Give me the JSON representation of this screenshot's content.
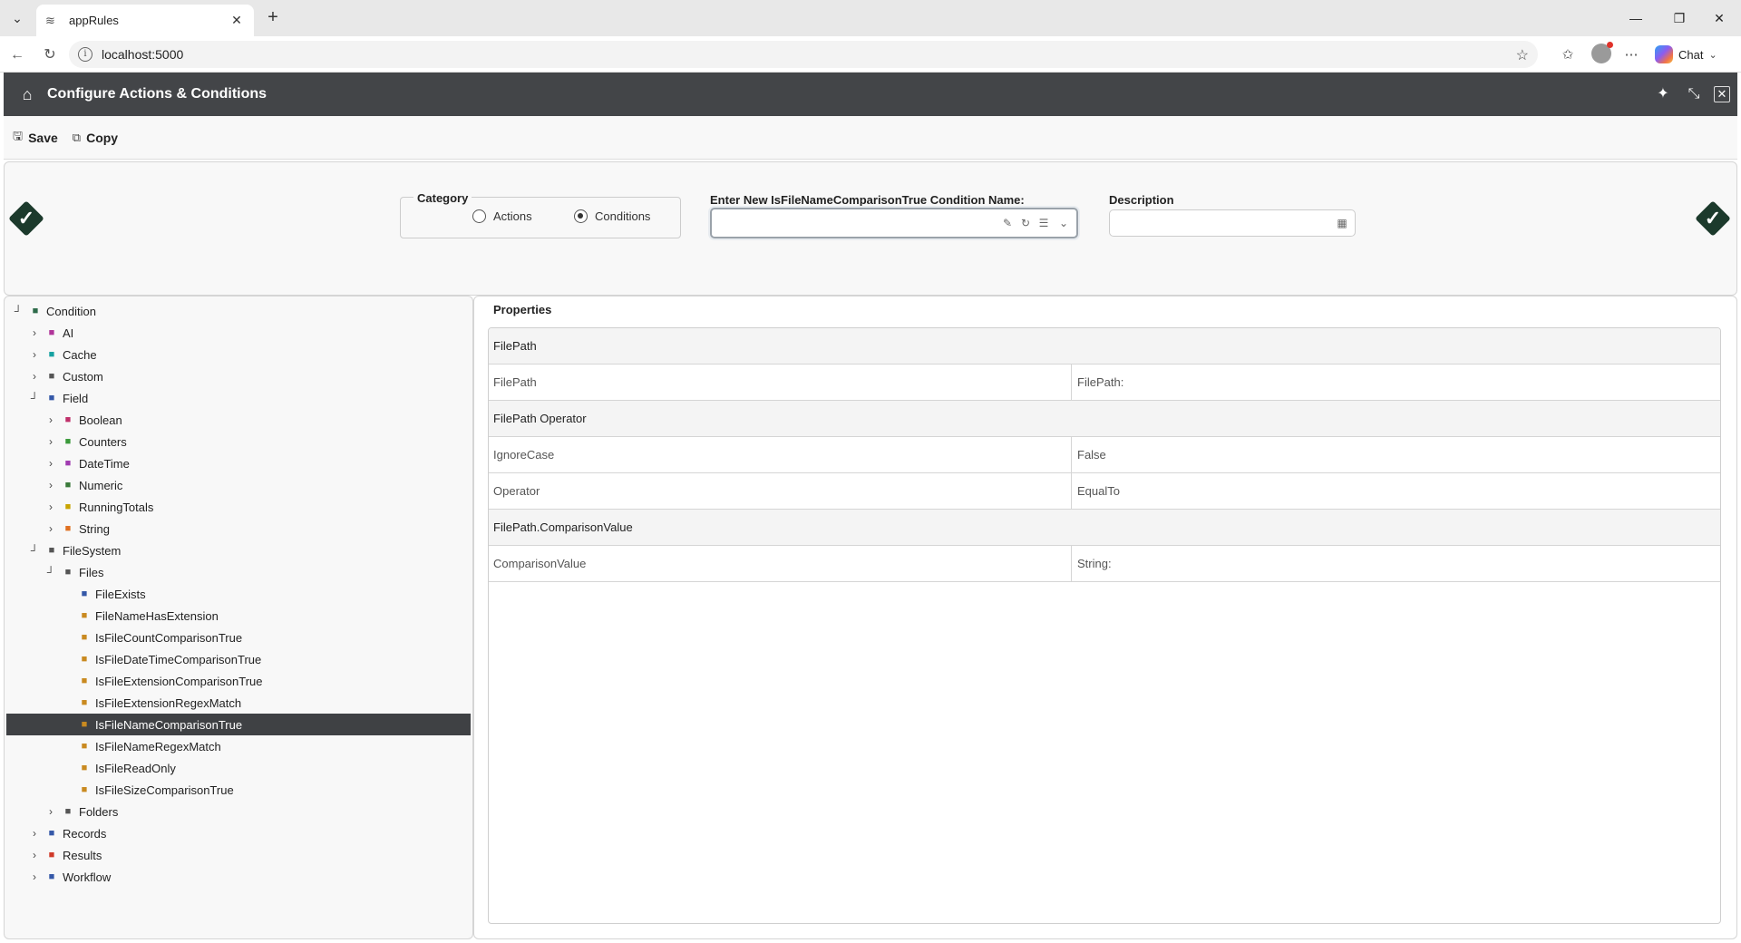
{
  "browser": {
    "tab_title": "appRules",
    "url": "localhost:5000",
    "chat_label": "Chat"
  },
  "app": {
    "title": "Configure Actions & Conditions"
  },
  "toolbar": {
    "save_label": "Save",
    "copy_label": "Copy"
  },
  "form": {
    "category_label": "Category",
    "category_options": [
      "Actions",
      "Conditions"
    ],
    "category_selected": "Conditions",
    "name_label": "Enter New IsFileNameComparisonTrue Condition Name:",
    "name_value": "",
    "description_label": "Description",
    "description_value": ""
  },
  "tree": {
    "items": [
      {
        "label": "Condition",
        "level": 0,
        "toggle": "collapse",
        "icon": "condition-icon",
        "color": "#2e6b4a"
      },
      {
        "label": "AI",
        "level": 1,
        "toggle": "expand",
        "icon": "ai-icon",
        "color": "#b0359a"
      },
      {
        "label": "Cache",
        "level": 1,
        "toggle": "expand",
        "icon": "cache-icon",
        "color": "#17a2a2"
      },
      {
        "label": "Custom",
        "level": 1,
        "toggle": "expand",
        "icon": "code-icon",
        "color": "#555555"
      },
      {
        "label": "Field",
        "level": 1,
        "toggle": "collapse",
        "icon": "field-icon",
        "color": "#3558a8"
      },
      {
        "label": "Boolean",
        "level": 2,
        "toggle": "expand",
        "icon": "boolean-icon",
        "color": "#c0306a"
      },
      {
        "label": "Counters",
        "level": 2,
        "toggle": "expand",
        "icon": "counters-icon",
        "color": "#3a9a3a"
      },
      {
        "label": "DateTime",
        "level": 2,
        "toggle": "expand",
        "icon": "calendar-icon",
        "color": "#a03ab0"
      },
      {
        "label": "Numeric",
        "level": 2,
        "toggle": "expand",
        "icon": "numeric-icon",
        "color": "#3a7a3a"
      },
      {
        "label": "RunningTotals",
        "level": 2,
        "toggle": "expand",
        "icon": "bar-chart-icon",
        "color": "#c9a400"
      },
      {
        "label": "String",
        "level": 2,
        "toggle": "expand",
        "icon": "string-icon",
        "color": "#e07020"
      },
      {
        "label": "FileSystem",
        "level": 1,
        "toggle": "collapse",
        "icon": "filesystem-icon",
        "color": "#555555"
      },
      {
        "label": "Files",
        "level": 2,
        "toggle": "collapse",
        "icon": "files-icon",
        "color": "#555555"
      },
      {
        "label": "FileExists",
        "level": 3,
        "toggle": "",
        "icon": "file-check-icon",
        "color": "#3558a8"
      },
      {
        "label": "FileNameHasExtension",
        "level": 3,
        "toggle": "",
        "icon": "file-ext-icon",
        "color": "#c98a20"
      },
      {
        "label": "IsFileCountComparisonTrue",
        "level": 3,
        "toggle": "",
        "icon": "file-icon",
        "color": "#c98a20"
      },
      {
        "label": "IsFileDateTimeComparisonTrue",
        "level": 3,
        "toggle": "",
        "icon": "file-icon",
        "color": "#c98a20"
      },
      {
        "label": "IsFileExtensionComparisonTrue",
        "level": 3,
        "toggle": "",
        "icon": "file-icon",
        "color": "#c98a20"
      },
      {
        "label": "IsFileExtensionRegexMatch",
        "level": 3,
        "toggle": "",
        "icon": "file-icon",
        "color": "#c98a20"
      },
      {
        "label": "IsFileNameComparisonTrue",
        "level": 3,
        "toggle": "",
        "icon": "file-icon",
        "color": "#c98a20",
        "selected": true
      },
      {
        "label": "IsFileNameRegexMatch",
        "level": 3,
        "toggle": "",
        "icon": "file-icon",
        "color": "#c98a20"
      },
      {
        "label": "IsFileReadOnly",
        "level": 3,
        "toggle": "",
        "icon": "file-lock-icon",
        "color": "#c98a20"
      },
      {
        "label": "IsFileSizeComparisonTrue",
        "level": 3,
        "toggle": "",
        "icon": "file-icon",
        "color": "#c98a20"
      },
      {
        "label": "Folders",
        "level": 2,
        "toggle": "expand",
        "icon": "folder-icon",
        "color": "#555555"
      },
      {
        "label": "Records",
        "level": 1,
        "toggle": "expand",
        "icon": "records-icon",
        "color": "#3558a8"
      },
      {
        "label": "Results",
        "level": 1,
        "toggle": "expand",
        "icon": "results-icon",
        "color": "#d03a2a"
      },
      {
        "label": "Workflow",
        "level": 1,
        "toggle": "expand",
        "icon": "workflow-icon",
        "color": "#3558a8"
      }
    ]
  },
  "properties": {
    "legend": "Properties",
    "rows": [
      {
        "type": "group",
        "label": "FilePath"
      },
      {
        "type": "item",
        "key": "FilePath",
        "value": "FilePath:"
      },
      {
        "type": "group",
        "label": "FilePath Operator"
      },
      {
        "type": "item",
        "key": "IgnoreCase",
        "value": "False"
      },
      {
        "type": "item",
        "key": "Operator",
        "value": "EqualTo"
      },
      {
        "type": "group",
        "label": "FilePath.ComparisonValue"
      },
      {
        "type": "item",
        "key": "ComparisonValue",
        "value": "String:"
      }
    ]
  }
}
